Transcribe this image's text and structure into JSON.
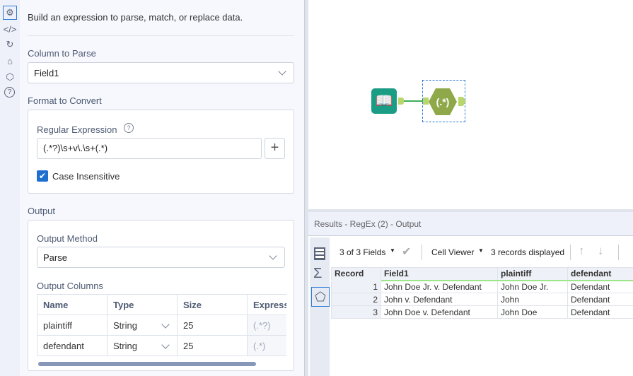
{
  "sidebar": {
    "icons": [
      "gear-icon",
      "code-icon",
      "rotate-icon",
      "tag-icon",
      "cube-icon",
      "help-icon"
    ]
  },
  "config": {
    "description": "Build an expression to parse, match, or replace data.",
    "column_to_parse_label": "Column to Parse",
    "column_to_parse_value": "Field1",
    "format_label": "Format to Convert",
    "regex_label": "Regular Expression",
    "regex_value": "(.*?)\\s+v\\.\\s+(.*)",
    "add_button": "+",
    "case_insensitive_label": "Case Insensitive",
    "case_insensitive_checked": true,
    "output_label": "Output",
    "output_method_label": "Output Method",
    "output_method_value": "Parse",
    "output_columns_label": "Output Columns",
    "output_columns_headers": [
      "Name",
      "Type",
      "Size",
      "Expressi"
    ],
    "output_columns_rows": [
      {
        "name": "plaintiff",
        "type": "String",
        "size": "25",
        "expression": "(.*?)"
      },
      {
        "name": "defendant",
        "type": "String",
        "size": "25",
        "expression": "(.*)"
      }
    ]
  },
  "canvas": {
    "tools": [
      "input-data-tool",
      "regex-tool"
    ],
    "regex_glyph": "(.*)",
    "colors": {
      "input": "#1b9c85",
      "regex": "#8fa84a",
      "anchor": "#b9d66a",
      "connector": "#3fae5a"
    }
  },
  "results": {
    "title": "Results - RegEx (2) - Output",
    "fields_label": "3 of 3 Fields",
    "viewer_label": "Cell Viewer",
    "records_label": "3 records displayed",
    "headers": [
      "Record",
      "Field1",
      "plaintiff",
      "defendant"
    ],
    "rows": [
      [
        "1",
        "John Doe Jr. v. Defendant",
        "John Doe Jr.",
        "Defendant"
      ],
      [
        "2",
        "John v. Defendant",
        "John",
        "Defendant"
      ],
      [
        "3",
        "John Doe v. Defendant",
        "John Doe",
        "Defendant"
      ]
    ]
  }
}
